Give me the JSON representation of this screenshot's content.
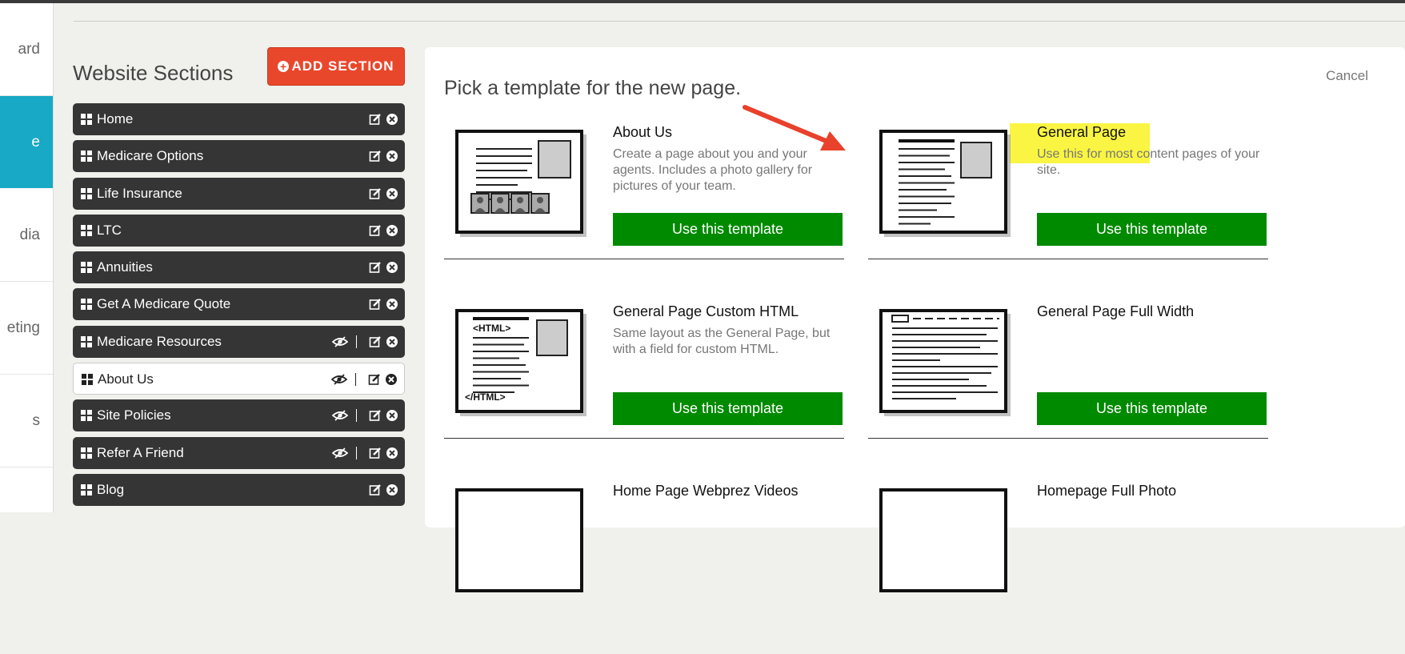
{
  "nav": {
    "items": [
      {
        "label": "ard",
        "active": false
      },
      {
        "label": "e",
        "active": true
      },
      {
        "label": "dia",
        "active": false
      },
      {
        "label": "eting",
        "active": false
      },
      {
        "label": "s",
        "active": false
      }
    ]
  },
  "sections": {
    "title": "Website Sections",
    "add_label": "ADD SECTION",
    "items": [
      {
        "label": "Home",
        "hidden": false,
        "selected": false
      },
      {
        "label": "Medicare Options",
        "hidden": false,
        "selected": false
      },
      {
        "label": "Life Insurance",
        "hidden": false,
        "selected": false
      },
      {
        "label": "LTC",
        "hidden": false,
        "selected": false
      },
      {
        "label": "Annuities",
        "hidden": false,
        "selected": false
      },
      {
        "label": "Get A Medicare Quote",
        "hidden": false,
        "selected": false
      },
      {
        "label": "Medicare Resources",
        "hidden": true,
        "selected": false
      },
      {
        "label": "About Us",
        "hidden": true,
        "selected": true
      },
      {
        "label": "Site Policies",
        "hidden": true,
        "selected": false
      },
      {
        "label": "Refer A Friend",
        "hidden": true,
        "selected": false
      },
      {
        "label": "Blog",
        "hidden": false,
        "selected": false
      }
    ]
  },
  "picker": {
    "title": "Pick a template for the new page.",
    "cancel_label": "Cancel",
    "use_label": "Use this template",
    "templates": [
      {
        "name": "About Us",
        "description": "Create a page about you and your agents. Includes a photo gallery for pictures of your team.",
        "thumb": "about-us"
      },
      {
        "name": "General Page",
        "description": "Use this for most content pages of your site.",
        "thumb": "general",
        "highlighted": true
      },
      {
        "name": "General Page Custom HTML",
        "description": "Same layout as the General Page, but with a field for custom HTML.",
        "thumb": "custom-html"
      },
      {
        "name": "General Page Full Width",
        "description": "",
        "thumb": "full-width"
      },
      {
        "name": "Home Page Webprez Videos",
        "description": "",
        "thumb": "partial"
      },
      {
        "name": "Homepage Full Photo",
        "description": "",
        "thumb": "partial"
      }
    ]
  },
  "colors": {
    "accent_teal": "#17a9c5",
    "add_button": "#e9472b",
    "use_button": "#008a00",
    "highlight": "#faf542",
    "arrow": "#e8412c"
  }
}
